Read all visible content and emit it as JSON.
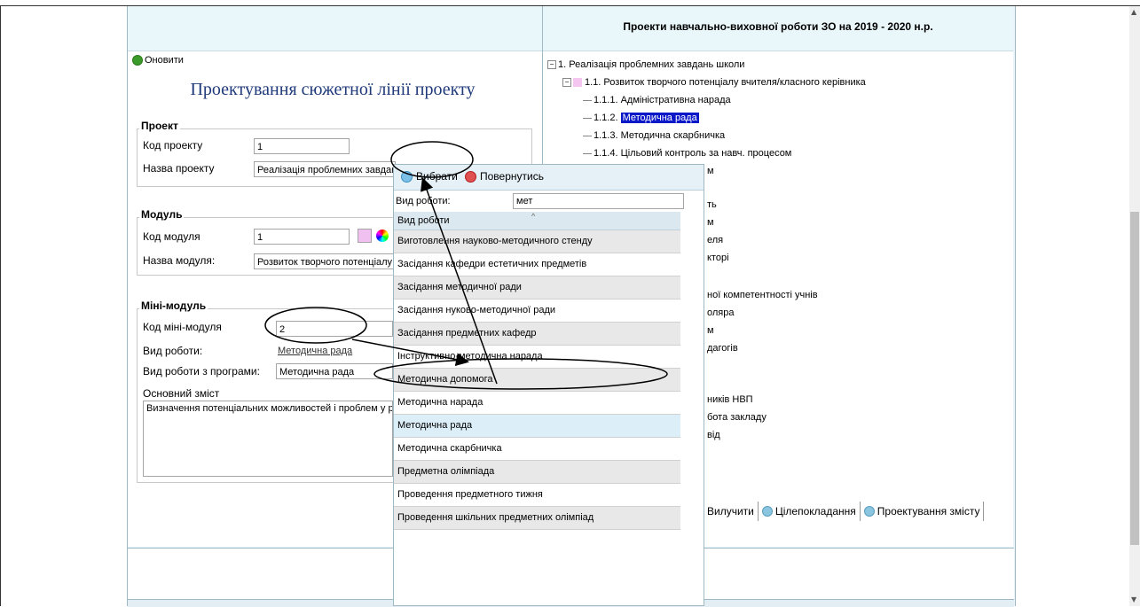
{
  "right_header": {
    "title": "Проекти навчально-виховної роботи ЗО на 2019 - 2020 н.р."
  },
  "left": {
    "refresh_label": "Оновити",
    "form_title": "Проектування сюжетної лінії проекту",
    "project": {
      "legend": "Проект",
      "code_label": "Код проекту",
      "code_value": "1",
      "name_label": "Назва проекту",
      "name_value": "Реалізація проблемних завдань"
    },
    "module": {
      "legend": "Модуль",
      "code_label": "Код модуля",
      "code_value": "1",
      "name_label": "Назва модуля:",
      "name_value": "Розвиток творчого потенціалу"
    },
    "minimodule": {
      "legend": "Міні-модуль",
      "code_label": "Код міні-модуля",
      "code_value": "2",
      "work_label": "Вид роботи:",
      "work_value": "Методична рада",
      "program_label": "Вид роботи з програми:",
      "program_value": "Методична рада",
      "content_label": "Основний зміст",
      "content_value": "Визначення потенціальних можливостей і проблем у р"
    }
  },
  "tree": {
    "n1": "1. Реалізація проблемних завдань школи",
    "n11": "1.1. Розвиток творчого потенціалу вчителя/класного керівника",
    "n111": "1.1.1. Адміністративна нарада",
    "n112": "1.1.2. Методична рада",
    "n113": "1.1.3. Методична скарбничка",
    "n114": "1.1.4. Цільовий контроль за навч. процесом",
    "p1": "м",
    "p2": "ть",
    "p3": "м",
    "p4": "еля",
    "p5": "кторі",
    "p6": "ної компетентності учнів",
    "p7": "оляра",
    "p8": "м",
    "p9": "дагогів",
    "p10": "ників НВП",
    "p11": "бота закладу",
    "p12": "від"
  },
  "tabs": {
    "exclude": "Вилучити",
    "goals": "Цілепокладання",
    "design": "Проектування змісту"
  },
  "popup": {
    "select_label": "Вибрати",
    "back_label": "Повернутись",
    "search_label": "Вид роботи:",
    "search_value": "мет",
    "column_header": "Вид роботи",
    "items": [
      "Виготовлення науково-методичного стенду",
      "Засідання кафедри естетичних предметів",
      "Засідання методичної ради",
      "Засідання нуково-методичної ради",
      "Засідання предметних кафедр",
      "Інструктивно-методична нарада",
      "Методична допомога",
      "Методична нарада",
      "Методична рада",
      "Методична скарбничка",
      "Предметна олімпіада",
      "Проведення предметного тижня",
      "Проведення шкільних предметних олімпіад"
    ]
  }
}
